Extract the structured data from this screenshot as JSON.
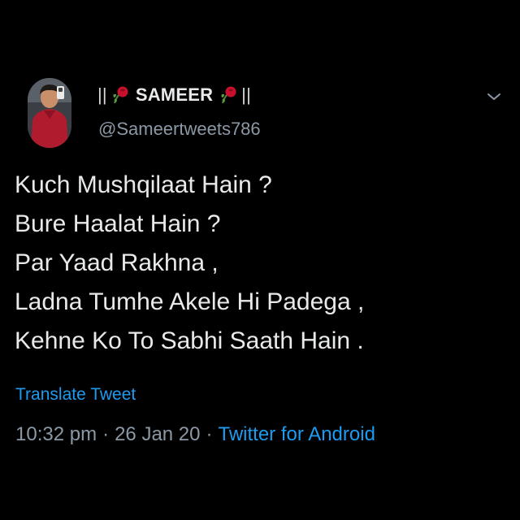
{
  "author": {
    "display_prefix": "||",
    "display_name": "SAMEER",
    "display_suffix": "||",
    "emoji_icon": "rose-emoji",
    "handle": "@Sameertweets786"
  },
  "tweet": {
    "lines": [
      "Kuch Mushqilaat Hain ?",
      "Bure Haalat Hain ?",
      "Par Yaad Rakhna ,",
      "Ladna Tumhe Akele Hi Padega ,",
      "Kehne Ko To Sabhi Saath Hain ."
    ],
    "translate_label": "Translate Tweet",
    "time": "10:32 pm",
    "date": "26 Jan 20",
    "separator": "·",
    "source": "Twitter for Android"
  },
  "colors": {
    "background": "#000000",
    "text": "#e7e9ea",
    "muted": "#8b98a5",
    "link": "#1d9bf0"
  },
  "icons": {
    "menu": "chevron-down-icon",
    "avatar": "avatar"
  }
}
